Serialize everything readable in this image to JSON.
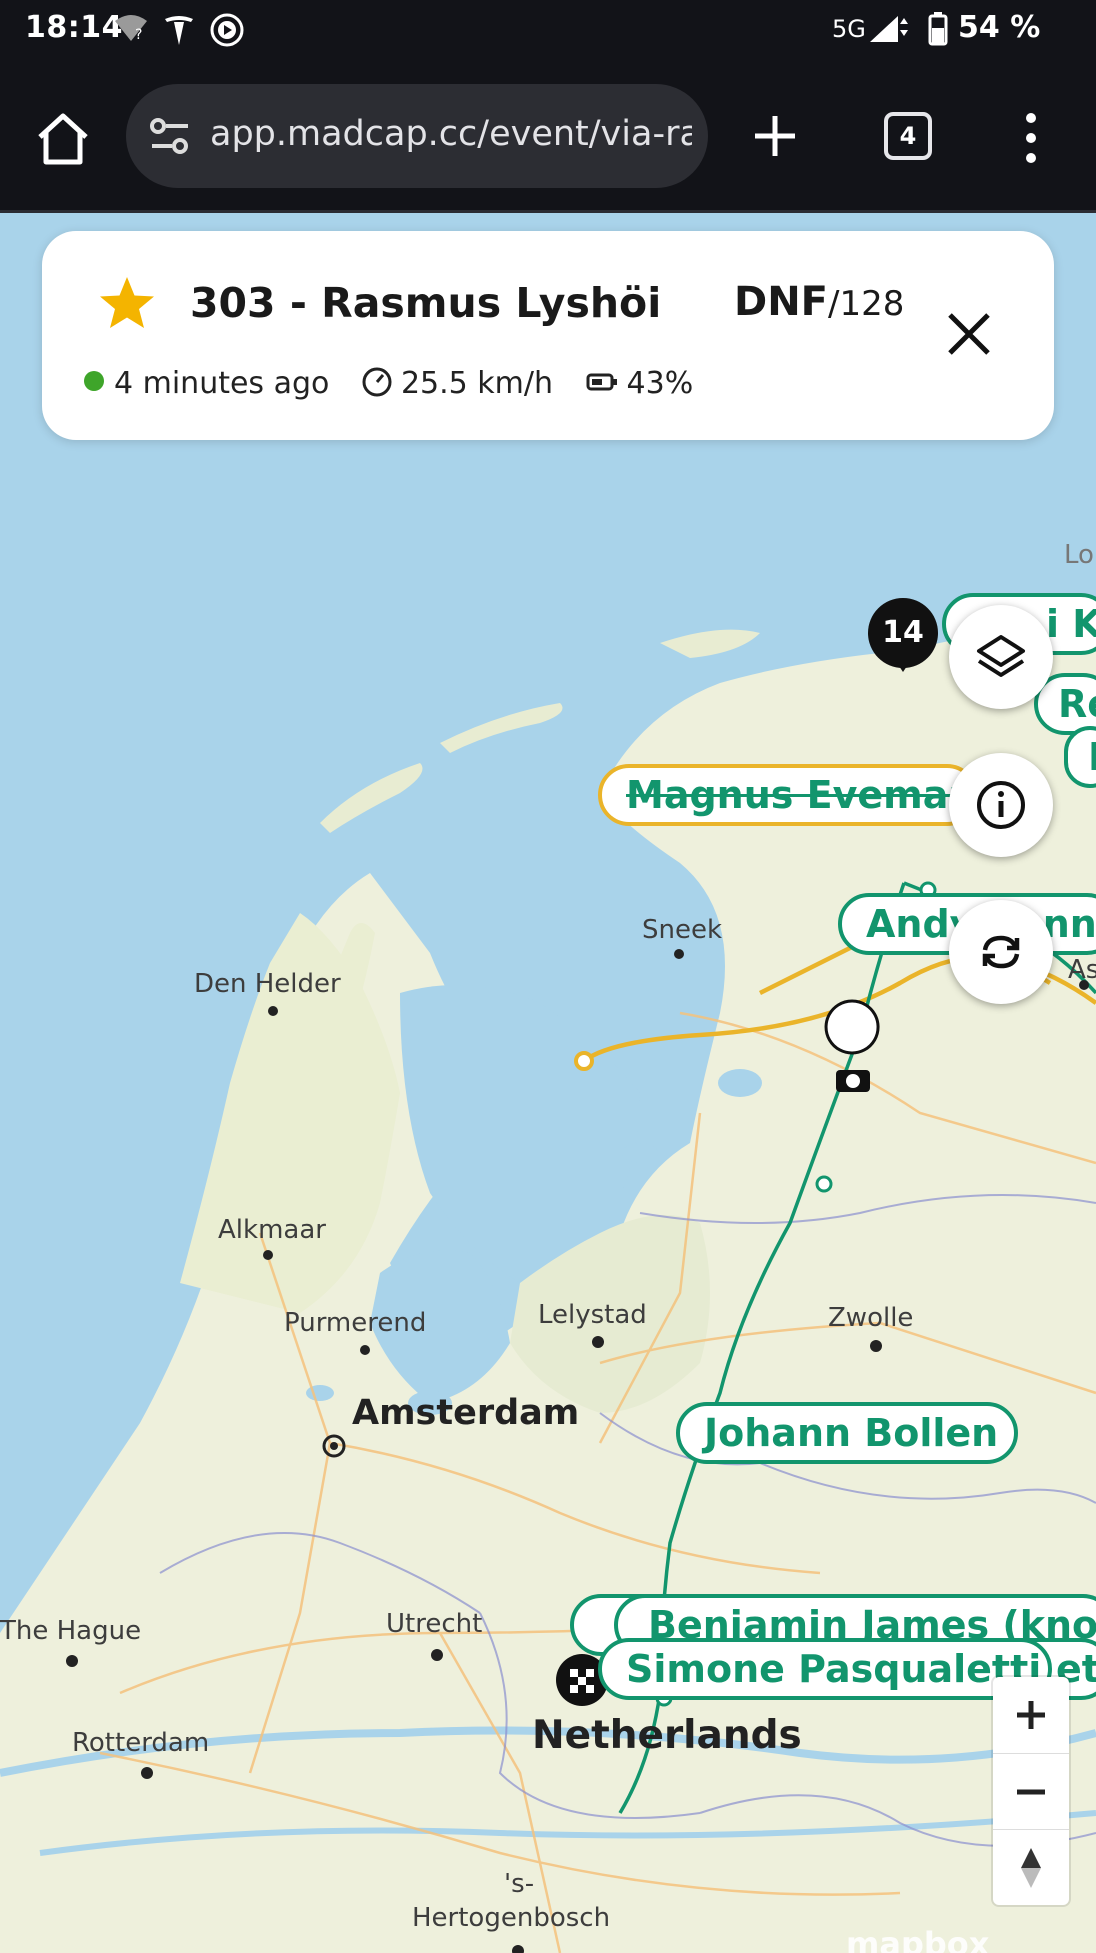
{
  "status_bar": {
    "time": "18:14",
    "network": "5G",
    "battery": "54 %"
  },
  "browser": {
    "url": "app.madcap.cc/event/via-rac",
    "tab_count": "4"
  },
  "rider_card": {
    "title": "303 - Rasmus Lyshöi",
    "status": "DNF",
    "total": "/128",
    "last_seen": "4 minutes ago",
    "speed": "25.5 km/h",
    "battery": "43%",
    "colors": {
      "star": "#f4b400",
      "online_dot": "#3ea52a"
    }
  },
  "map": {
    "places": {
      "lo": "Lo",
      "sneek": "Sneek",
      "den_helder": "Den Helder",
      "alkmaar": "Alkmaar",
      "purmerend": "Purmerend",
      "lelystad": "Lelystad",
      "zwolle": "Zwolle",
      "amsterdam": "Amsterdam",
      "the_hague": "The Hague",
      "utrecht": "Utrecht",
      "netherlands": "Netherlands",
      "rotterdam": "Rotterdam",
      "s_hertogenbosch_1": "'s-",
      "s_hertogenbosch_2": "Hertogenbosch",
      "ass": "Ass"
    },
    "riders": {
      "top_right_1": "i K",
      "top_right_2": "Re",
      "top_right_3": "I",
      "magnus": "Magnus Eveman",
      "andy": "Andy Kanne",
      "johann": "Johann Bollen",
      "benjamin": "Benjamin James (known",
      "simone": "Simone Pasqualetti",
      "simone_tail": "etr"
    },
    "cluster_count": "14",
    "attribution": "mapbox",
    "colors": {
      "green_route": "#12956d",
      "yellow_route": "#eab42a",
      "water": "#a9d3ea",
      "land": "#eef0dc"
    }
  }
}
